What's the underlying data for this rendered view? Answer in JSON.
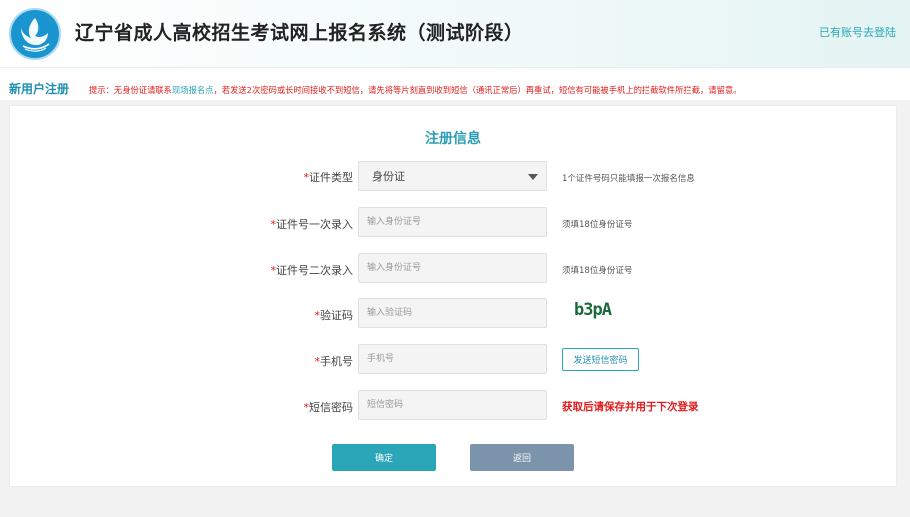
{
  "header": {
    "title": "辽宁省成人高校招生考试网上报名系统（测试阶段）",
    "login_link": "已有账号去登陆",
    "logo_icon": "dove-logo-icon"
  },
  "notice": {
    "section_label": "新用户注册",
    "prefix": "提示：无身份证请联系",
    "link": "现场报名点",
    "rest": "，若发送2次密码或长时间接收不到短信，请先将等片刻直到收到短信（通讯正常后）再重试，短信有可能被手机上的拦截软件所拦截，请留意。"
  },
  "form": {
    "title": "注册信息",
    "required_mark": "*",
    "id_type": {
      "label": "证件类型",
      "value": "身份证",
      "hint": "1个证件号码只能填报一次报名信息"
    },
    "id_first": {
      "label": "证件号一次录入",
      "placeholder": "输入身份证号",
      "hint": "须填18位身份证号"
    },
    "id_second": {
      "label": "证件号二次录入",
      "placeholder": "输入身份证号",
      "hint": "须填18位身份证号"
    },
    "captcha": {
      "label": "验证码",
      "placeholder": "输入验证码",
      "code": "b3pA"
    },
    "phone": {
      "label": "手机号",
      "placeholder": "手机号",
      "button": "发送短信密码"
    },
    "sms_password": {
      "label": "短信密码",
      "placeholder": "短信密码",
      "hint": "获取后请保存并用于下次登录"
    },
    "buttons": {
      "confirm": "确定",
      "back": "返回"
    }
  },
  "colors": {
    "accent": "#2aa6b8",
    "required": "#e11c1c",
    "back_button": "#7b93ab"
  }
}
